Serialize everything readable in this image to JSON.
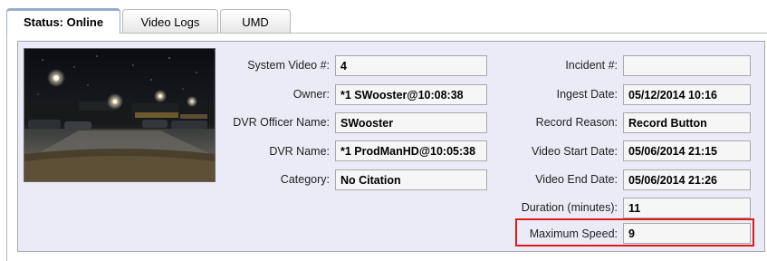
{
  "tabs": [
    {
      "label": "Status: Online",
      "active": true
    },
    {
      "label": "Video Logs",
      "active": false
    },
    {
      "label": "UMD",
      "active": false
    }
  ],
  "left_fields": [
    {
      "label": "System Video #:",
      "value": "4"
    },
    {
      "label": "Owner:",
      "value": "*1 SWooster@10:08:38"
    },
    {
      "label": "DVR Officer Name:",
      "value": "SWooster"
    },
    {
      "label": "DVR Name:",
      "value": "*1 ProdManHD@10:05:38"
    },
    {
      "label": "Category:",
      "value": "No Citation"
    }
  ],
  "right_fields": [
    {
      "label": "Incident #:",
      "value": ""
    },
    {
      "label": "Ingest Date:",
      "value": "05/12/2014 10:16"
    },
    {
      "label": "Record Reason:",
      "value": "Record Button"
    },
    {
      "label": "Video Start Date:",
      "value": "05/06/2014 21:15"
    },
    {
      "label": "Video End Date:",
      "value": "05/06/2014 21:26"
    },
    {
      "label": "Duration (minutes):",
      "value": "11"
    },
    {
      "label": "Maximum Speed:",
      "value": "9"
    }
  ],
  "colors": {
    "panel_bg": "#ebebf7",
    "highlight": "#e01a1a",
    "active_tab_accent": "#8aa1c8"
  }
}
